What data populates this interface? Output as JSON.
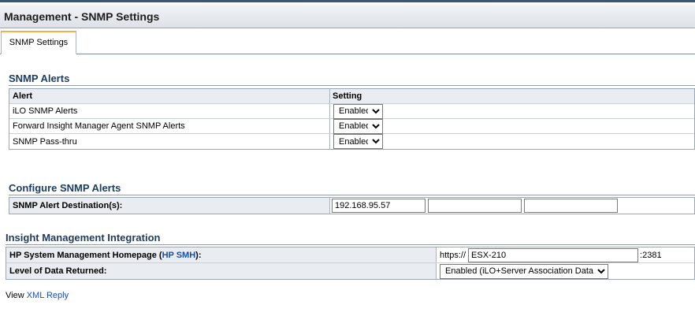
{
  "page": {
    "title": "Management - SNMP Settings"
  },
  "tabs": [
    {
      "label": "SNMP Settings"
    }
  ],
  "snmp_alerts": {
    "heading": "SNMP Alerts",
    "columns": [
      "Alert",
      "Setting"
    ],
    "rows": [
      {
        "alert": "iLO SNMP Alerts",
        "setting": "Enabled"
      },
      {
        "alert": "Forward Insight Manager Agent SNMP Alerts",
        "setting": "Enabled"
      },
      {
        "alert": "SNMP Pass-thru",
        "setting": "Enabled"
      }
    ]
  },
  "configure": {
    "heading": "Configure SNMP Alerts",
    "label": "SNMP Alert Destination(s):",
    "destinations": [
      "192.168.95.57",
      "",
      ""
    ]
  },
  "insight": {
    "heading": "Insight Management Integration",
    "homepage_label": "HP System Management Homepage (",
    "homepage_link": "HP SMH",
    "homepage_label_end": "):",
    "https_prefix": "https://",
    "host": "ESX-210",
    "port_suffix": ":2381",
    "level_label": "Level of Data Returned:",
    "level_value": "Enabled (iLO+Server Association Data)"
  },
  "footer": {
    "view_text": "View ",
    "link_text": "XML Reply"
  }
}
